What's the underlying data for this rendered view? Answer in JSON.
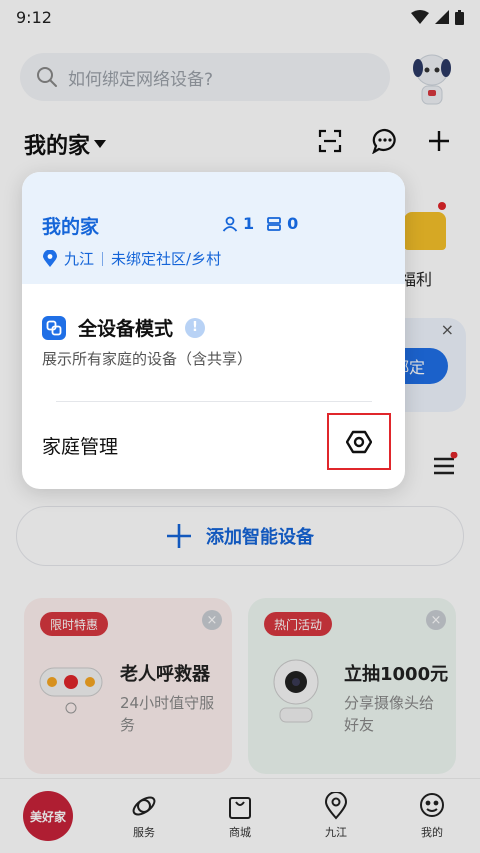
{
  "status_bar": {
    "time": "9:12"
  },
  "search": {
    "placeholder": "如何绑定网络设备?"
  },
  "header": {
    "home_name": "我的家"
  },
  "background": {
    "welfare_label": "福利",
    "bind_label": "绑定",
    "add_device_label": "添加智能设备",
    "promo_left": {
      "tag": "限时特惠",
      "title": "老人呼救器",
      "desc": "24小时值守服务"
    },
    "promo_right": {
      "tag": "热门活动",
      "title": "立抽1000元",
      "desc": "分享摄像头给好友"
    }
  },
  "dropdown": {
    "home": {
      "name": "我的家",
      "members": "1",
      "devices": "0",
      "city": "九江",
      "community": "未绑定社区/乡村"
    },
    "mode": {
      "title": "全设备模式",
      "desc": "展示所有家庭的设备（含共享）"
    },
    "manage_label": "家庭管理"
  },
  "bottom_nav": [
    {
      "label": ""
    },
    {
      "label": "服务"
    },
    {
      "label": "商城"
    },
    {
      "label": "九江"
    },
    {
      "label": "我的"
    }
  ],
  "logo_text": "美好家",
  "colors": {
    "accent": "#1565d8",
    "highlight_box": "#e0262b",
    "brand_red": "#c8233a"
  }
}
